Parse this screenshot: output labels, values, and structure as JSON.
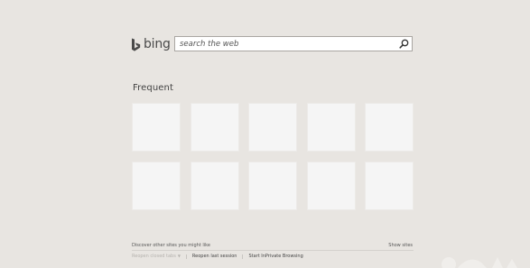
{
  "logo": {
    "text": "bing"
  },
  "search": {
    "placeholder": "search the web"
  },
  "frequent": {
    "title": "Frequent",
    "tiles": [
      "",
      "",
      "",
      "",
      "",
      "",
      "",
      "",
      "",
      ""
    ]
  },
  "footer": {
    "discover_text": "Discover other sites you might like",
    "show_sites": "Show sites",
    "reopen_closed_tabs": "Reopen closed tabs",
    "reopen_last_session": "Reopen last session",
    "start_inprivate": "Start InPrivate Browsing"
  },
  "colors": {
    "background": "#e8e5e1",
    "tile": "#f5f5f5",
    "search_border": "#a9a6a2"
  }
}
